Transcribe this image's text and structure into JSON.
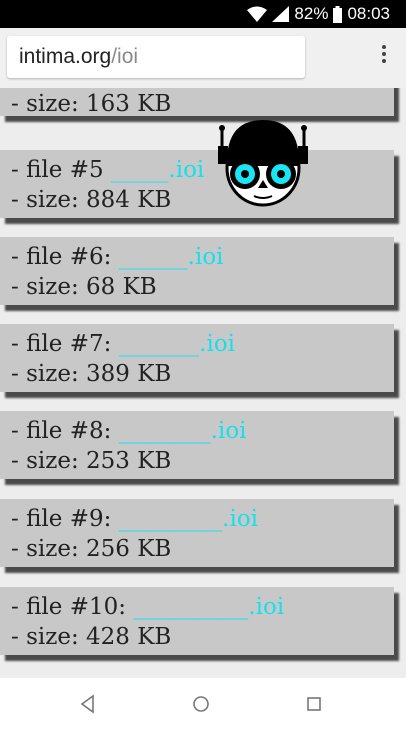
{
  "status": {
    "battery": "82%",
    "time": "08:03"
  },
  "browser": {
    "url_domain": "intima.org",
    "url_path": "/ioi"
  },
  "files": [
    {
      "title": "",
      "link": "",
      "size": "- size: 163 KB"
    },
    {
      "title": "- file #5 ",
      "link": "_____.ioi",
      "size": "- size: 884 KB"
    },
    {
      "title": "- file #6: ",
      "link": "______.ioi",
      "size": "- size: 68 KB"
    },
    {
      "title": "- file #7: ",
      "link": "_______.ioi",
      "size": "- size: 389 KB"
    },
    {
      "title": "- file #8: ",
      "link": "________.ioi",
      "size": "- size: 253 KB"
    },
    {
      "title": "- file #9: ",
      "link": "_________.ioi",
      "size": "- size: 256 KB"
    },
    {
      "title": "- file #10: ",
      "link": "__________.ioi",
      "size": "- size: 428 KB"
    }
  ],
  "icons": {
    "wifi": "wifi-icon",
    "signal": "signal-icon",
    "battery": "battery-icon",
    "menu": "overflow-menu-icon",
    "back": "back-icon",
    "home": "home-icon",
    "recents": "recents-icon",
    "mascot": "robot-mascot-icon"
  },
  "colors": {
    "link": "#16e0ee",
    "card": "#c8c8c8",
    "shadow": "#4a4a4a"
  }
}
